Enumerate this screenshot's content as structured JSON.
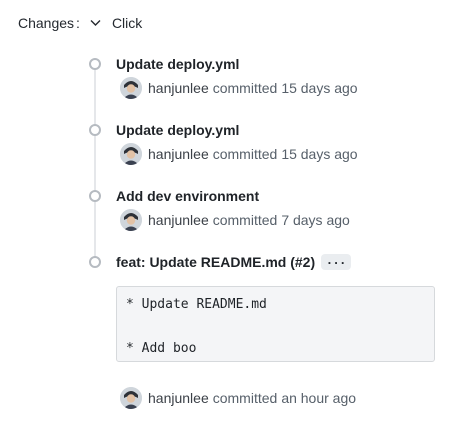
{
  "changes": {
    "label": "Changes",
    "separator": ":",
    "mode": "Click"
  },
  "commits": [
    {
      "title": "Update deploy.yml",
      "author": "hanjunlee",
      "action": "committed",
      "time": "15 days ago"
    },
    {
      "title": "Update deploy.yml",
      "author": "hanjunlee",
      "action": "committed",
      "time": "15 days ago"
    },
    {
      "title": "Add dev environment",
      "author": "hanjunlee",
      "action": "committed",
      "time": "7 days ago"
    },
    {
      "title": "feat: Update README.md (#2)",
      "ellipsis": "...",
      "author": "hanjunlee",
      "action": "committed",
      "time": "an hour ago",
      "message_lines": [
        "* Update README.md",
        "* Add boo"
      ]
    }
  ],
  "icons": {
    "chevron": "chevron-down-icon",
    "avatar": "avatar"
  }
}
